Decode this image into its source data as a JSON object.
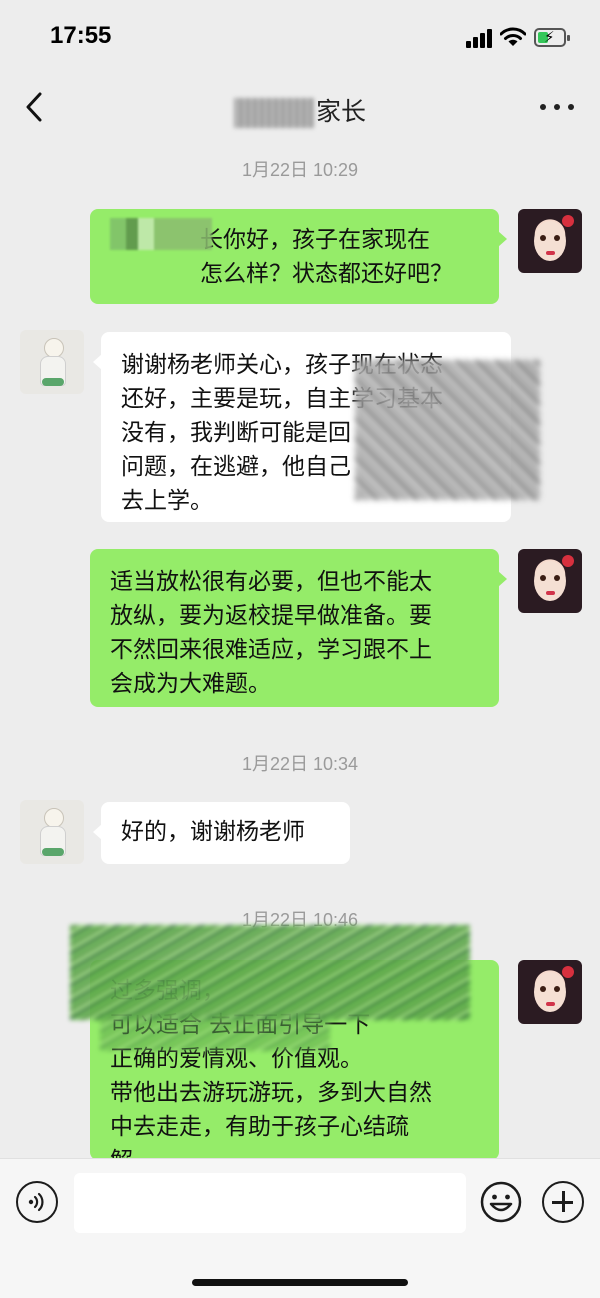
{
  "status_bar": {
    "time": "17:55"
  },
  "header": {
    "title": "家长"
  },
  "messages": [
    {
      "type": "timestamp",
      "text": "1月22日 10:29"
    },
    {
      "type": "sent",
      "text": "长你好，孩子在家现在\n怎么样？状态都还好吧？"
    },
    {
      "type": "received",
      "text": "谢谢杨老师关心，孩子现在状态\n还好，主要是玩，自主学习基本\n没有，我判断可能是回\n问题，在逃避，他自己\n去上学。"
    },
    {
      "type": "sent",
      "text": "适当放松很有必要，但也不能太\n放纵，要为返校提早做准备。要\n不然回来很难适应，学习跟不上\n会成为大难题。"
    },
    {
      "type": "timestamp",
      "text": "1月22日 10:34"
    },
    {
      "type": "received",
      "text": "好的，谢谢杨老师"
    },
    {
      "type": "timestamp",
      "text": "1月22日 10:46"
    },
    {
      "type": "sent",
      "text": "过多强调，\n可以适合               去正面引导一下\n正确的爱情观、价值观。\n带他出去游玩游玩，多到大自然\n中去走走，有助于孩子心结疏\n解。"
    }
  ],
  "input_bar": {
    "placeholder": ""
  },
  "icons": [
    "back-icon",
    "more-icon",
    "voice-icon",
    "emoji-icon",
    "plus-icon"
  ]
}
